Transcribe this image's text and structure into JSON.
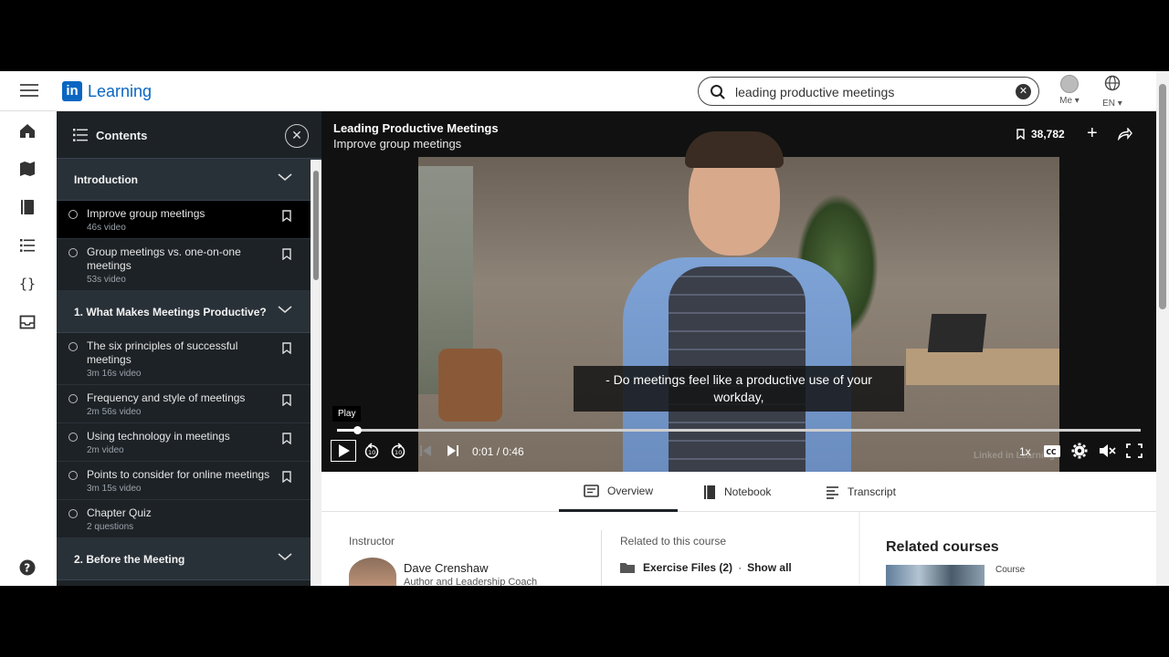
{
  "app": {
    "brand_mark": "in",
    "brand_name": "Learning"
  },
  "search": {
    "value": "leading productive meetings",
    "placeholder": "Search"
  },
  "account": {
    "me_label": "Me ▾",
    "lang_label": "EN ▾"
  },
  "contents": {
    "title": "Contents",
    "sections": [
      {
        "title": "Introduction",
        "items": [
          {
            "title": "Improve group meetings",
            "meta": "46s video",
            "active": true
          },
          {
            "title": "Group meetings vs. one-on-one meetings",
            "meta": "53s video"
          }
        ]
      },
      {
        "title": "1. What Makes Meetings Productive?",
        "items": [
          {
            "title": "The six principles of successful meetings",
            "meta": "3m 16s video"
          },
          {
            "title": "Frequency and style of meetings",
            "meta": "2m 56s video"
          },
          {
            "title": "Using technology in meetings",
            "meta": "2m video"
          },
          {
            "title": "Points to consider for online meetings",
            "meta": "3m 15s video"
          },
          {
            "title": "Chapter Quiz",
            "meta": "2 questions"
          }
        ]
      },
      {
        "title": "2. Before the Meeting",
        "items": []
      }
    ]
  },
  "video": {
    "course_title": "Leading Productive Meetings",
    "video_title": "Improve group meetings",
    "saves": "38,782",
    "caption": "- Do meetings feel like a productive use of your workday,",
    "tooltip": "Play",
    "time": "0:01 / 0:46",
    "progress": 0.025,
    "speed": "1x",
    "watermark": "Linked in Learning"
  },
  "tabs": [
    {
      "label": "Overview",
      "icon": "overview-icon",
      "active": true
    },
    {
      "label": "Notebook",
      "icon": "notebook-icon"
    },
    {
      "label": "Transcript",
      "icon": "transcript-icon"
    }
  ],
  "overview": {
    "instructor_label": "Instructor",
    "instructor_name": "Dave Crenshaw",
    "instructor_role": "Author and Leadership Coach",
    "related_label": "Related to this course",
    "exercise_files": "Exercise Files (2)",
    "separator": "·",
    "show_all": "Show all"
  },
  "related": {
    "title": "Related courses",
    "type": "Course"
  },
  "colors": {
    "brand": "#0a66c2",
    "panel": "#1d2226"
  }
}
